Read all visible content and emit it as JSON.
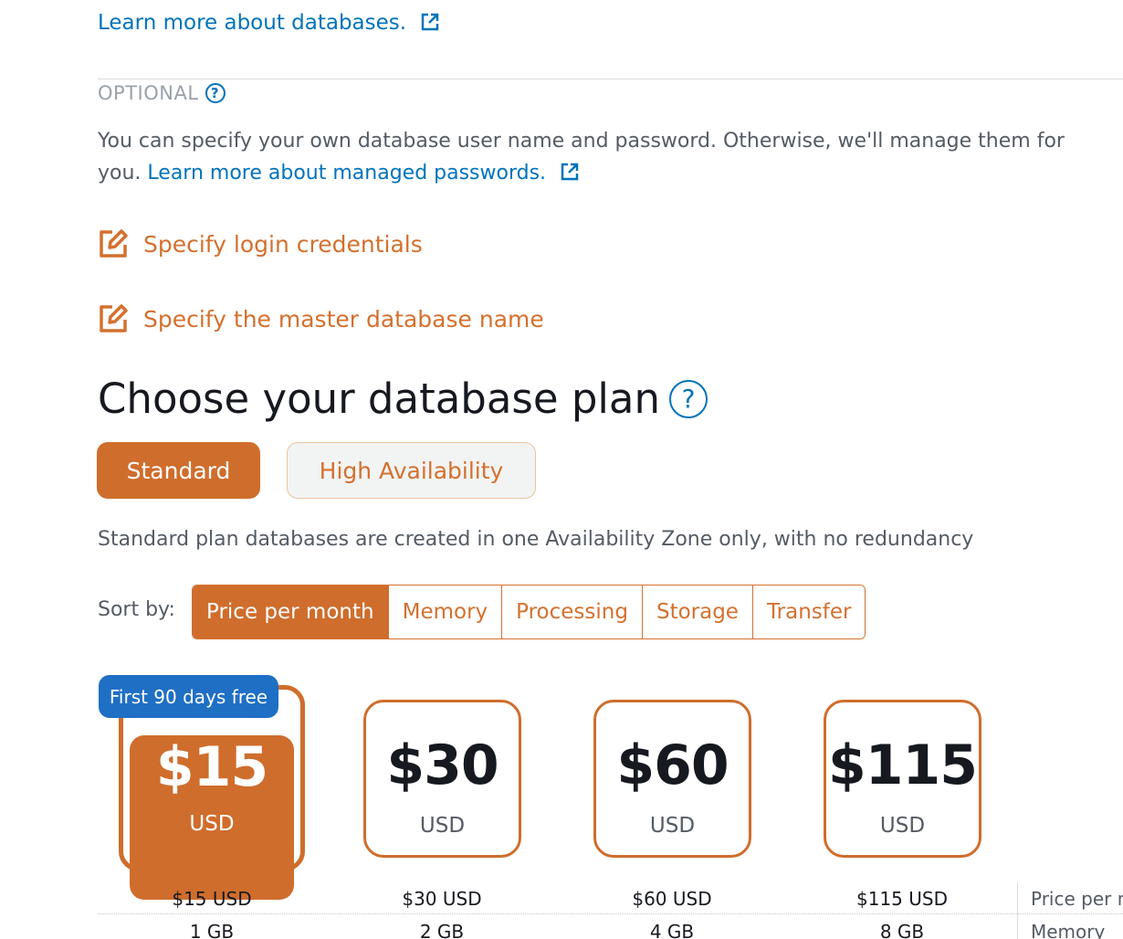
{
  "links": {
    "learn_databases": "Learn more about databases.",
    "learn_passwords": "Learn more about managed passwords."
  },
  "optional": {
    "label": "OPTIONAL",
    "help": "?"
  },
  "description": {
    "text": "You can specify your own database user name and password. Otherwise, we'll manage them for you."
  },
  "edit_options": [
    {
      "label": "Specify login credentials"
    },
    {
      "label": "Specify the master database name"
    }
  ],
  "plan": {
    "title": "Choose your database plan",
    "help": "?",
    "options": [
      "Standard",
      "High Availability"
    ],
    "selected": "Standard",
    "note": "Standard plan databases are created in one Availability Zone only, with no redundancy"
  },
  "sort": {
    "label": "Sort by:",
    "options": [
      "Price per month",
      "Memory",
      "Processing",
      "Storage",
      "Transfer"
    ],
    "active": "Price per month"
  },
  "promo_badge": "First 90 days free",
  "bundles": [
    {
      "price": "$15",
      "currency": "USD",
      "price_full": "$15 USD",
      "memory": "1 GB",
      "selected": true
    },
    {
      "price": "$30",
      "currency": "USD",
      "price_full": "$30 USD",
      "memory": "2 GB",
      "selected": false
    },
    {
      "price": "$60",
      "currency": "USD",
      "price_full": "$60 USD",
      "memory": "4 GB",
      "selected": false
    },
    {
      "price": "$115",
      "currency": "USD",
      "price_full": "$115 USD",
      "memory": "8 GB",
      "selected": false
    }
  ],
  "spec_labels": {
    "price": "Price per m",
    "memory": "Memory"
  },
  "colors": {
    "accent": "#cf6d2c",
    "link": "#0073bb",
    "badge": "#1f6fc5"
  }
}
